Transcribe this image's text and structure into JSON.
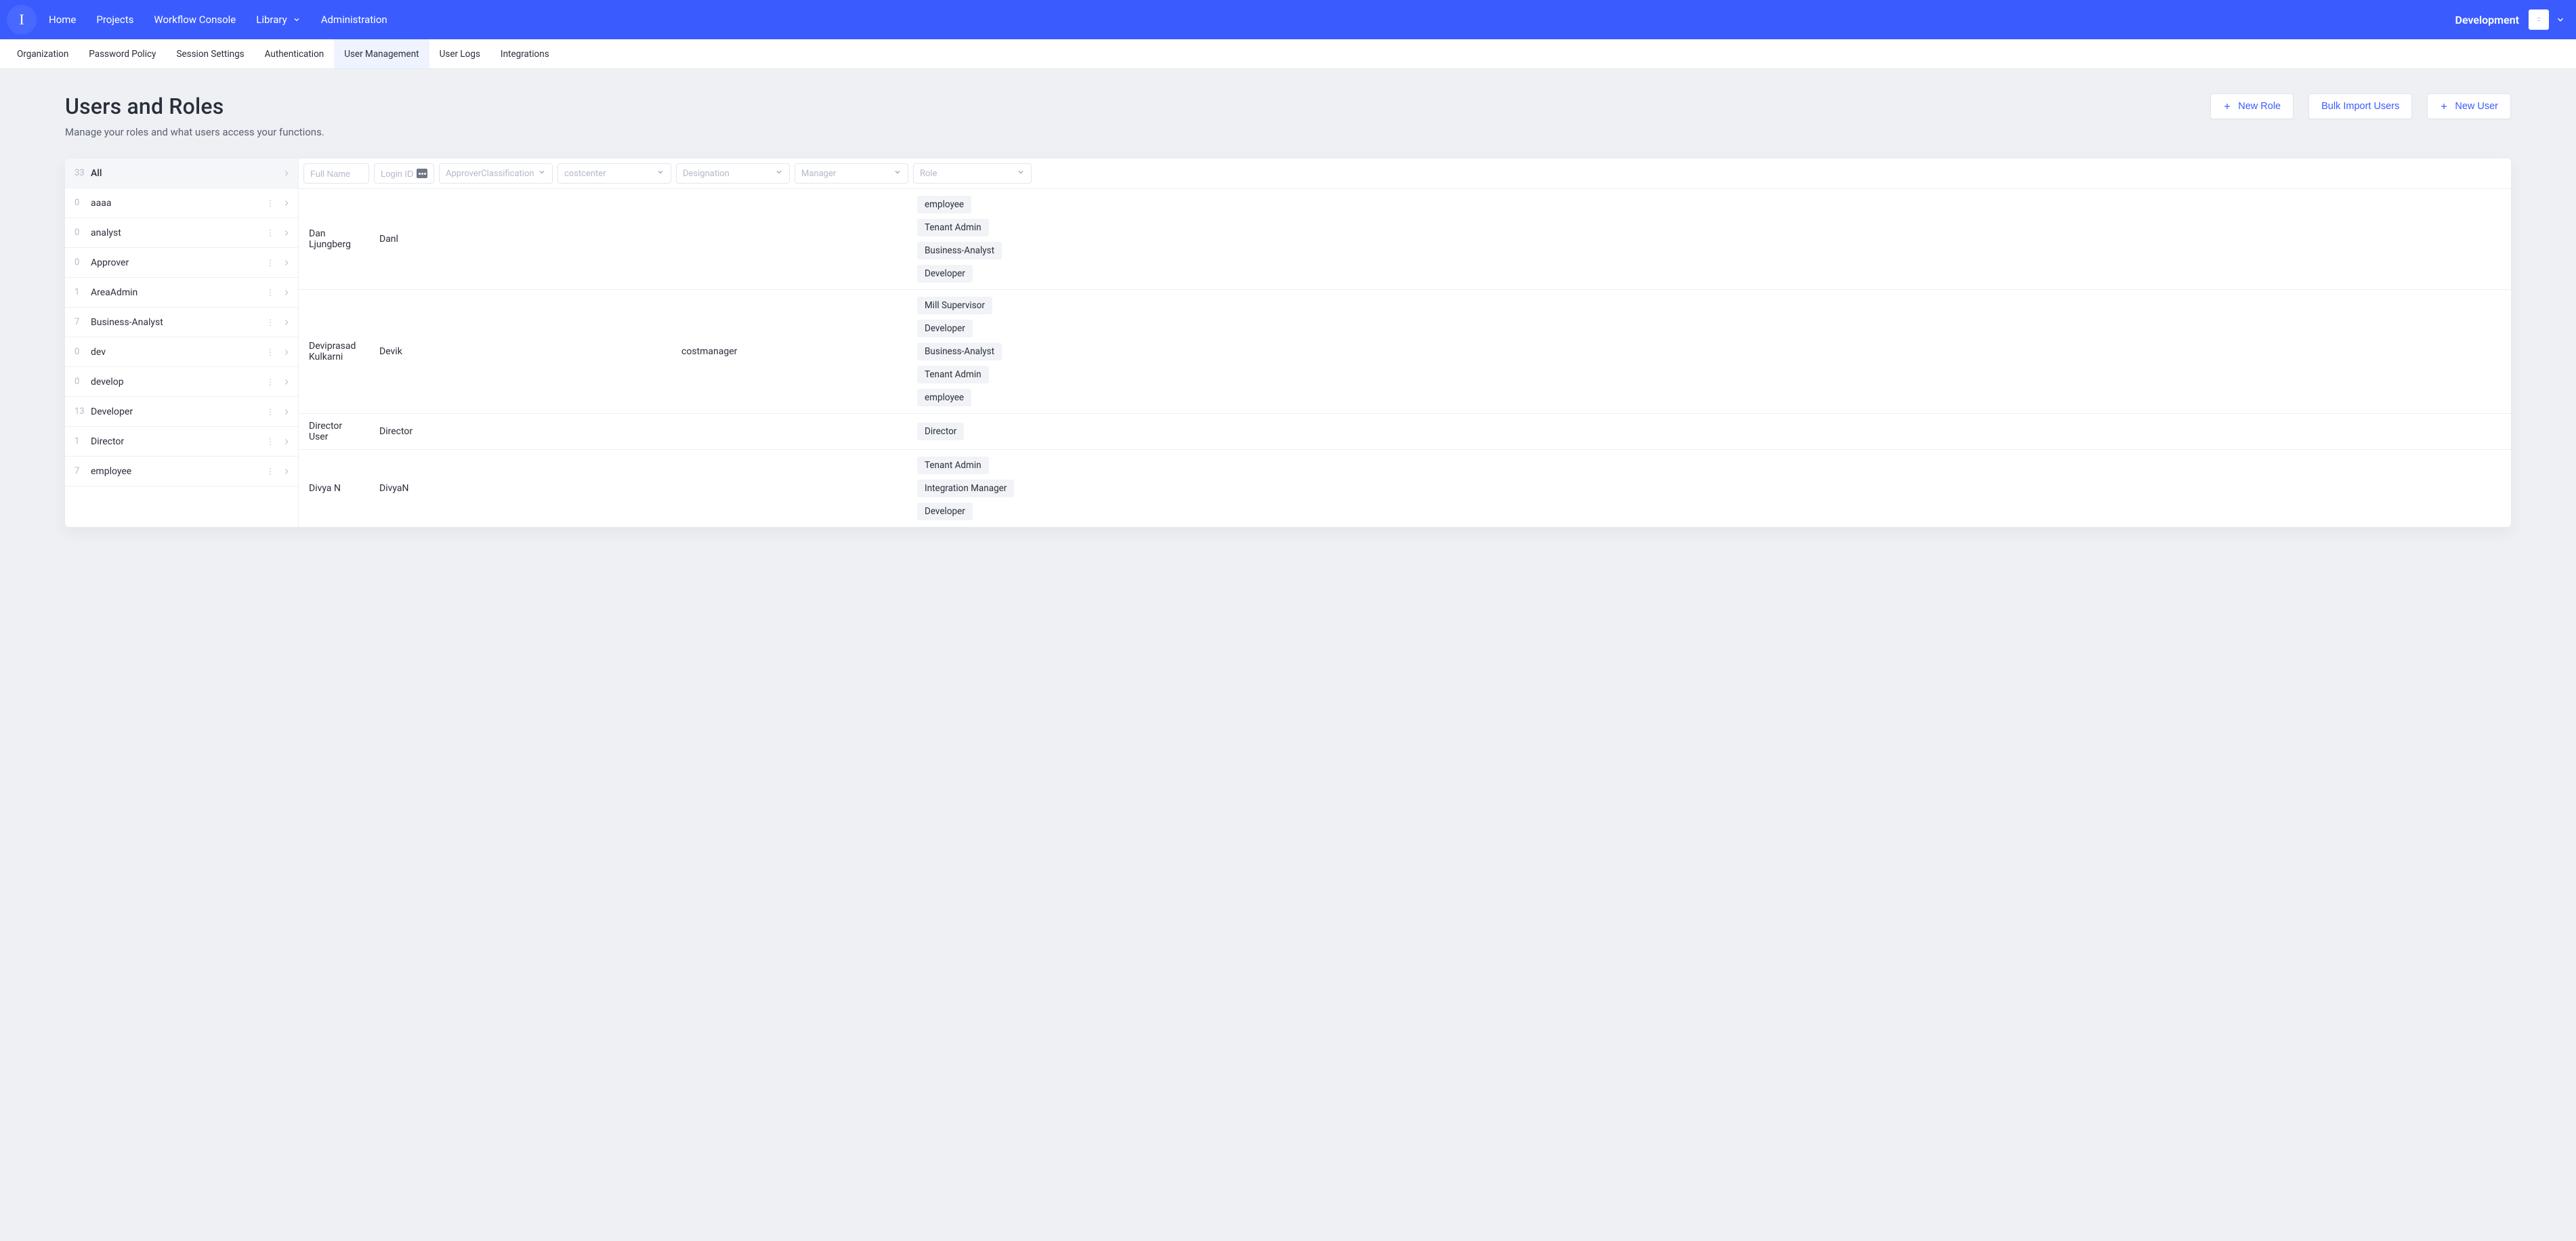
{
  "topnav": {
    "logo_letter": "I",
    "items": [
      "Home",
      "Projects",
      "Workflow Console",
      "Library",
      "Administration"
    ],
    "library_has_dropdown": true,
    "env_label": "Development",
    "avatar_glyph": "::"
  },
  "subnav": {
    "tabs": [
      "Organization",
      "Password Policy",
      "Session Settings",
      "Authentication",
      "User Management",
      "User Logs",
      "Integrations"
    ],
    "active_index": 4
  },
  "page": {
    "title": "Users and Roles",
    "subtitle": "Manage your roles and what users access your functions.",
    "actions": {
      "new_role": "New Role",
      "bulk_import": "Bulk Import Users",
      "new_user": "New User"
    }
  },
  "roles_sidebar": {
    "all_count": "33",
    "all_label": "All",
    "items": [
      {
        "count": "0",
        "label": "aaaa"
      },
      {
        "count": "0",
        "label": "analyst"
      },
      {
        "count": "0",
        "label": "Approver"
      },
      {
        "count": "1",
        "label": "AreaAdmin"
      },
      {
        "count": "7",
        "label": "Business-Analyst"
      },
      {
        "count": "0",
        "label": "dev"
      },
      {
        "count": "0",
        "label": "develop"
      },
      {
        "count": "13",
        "label": "Developer"
      },
      {
        "count": "1",
        "label": "Director"
      },
      {
        "count": "7",
        "label": "employee"
      }
    ]
  },
  "table": {
    "filters": {
      "full_name": "Full Name",
      "login_id": "Login ID",
      "approver": "ApproverClassification",
      "costcenter": "costcenter",
      "designation": "Designation",
      "manager": "Manager",
      "role": "Role"
    },
    "rows": [
      {
        "full_name": "Dan Ljungberg",
        "login_id": "Danl",
        "approver": "",
        "costcenter": "",
        "designation": "",
        "manager": "",
        "roles": [
          "employee",
          "Tenant Admin",
          "Business-Analyst",
          "Developer"
        ]
      },
      {
        "full_name": "Deviprasad Kulkarni",
        "login_id": "Devik",
        "approver": "",
        "costcenter": "",
        "designation": "costmanager",
        "manager": "",
        "roles": [
          "Mill Supervisor",
          "Developer",
          "Business-Analyst",
          "Tenant Admin",
          "employee"
        ]
      },
      {
        "full_name": "Director User",
        "login_id": "Director",
        "approver": "",
        "costcenter": "",
        "designation": "",
        "manager": "",
        "roles": [
          "Director"
        ]
      },
      {
        "full_name": "Divya N",
        "login_id": "DivyaN",
        "approver": "",
        "costcenter": "",
        "designation": "",
        "manager": "",
        "roles": [
          "Tenant Admin",
          "Integration Manager",
          "Developer"
        ]
      }
    ]
  }
}
